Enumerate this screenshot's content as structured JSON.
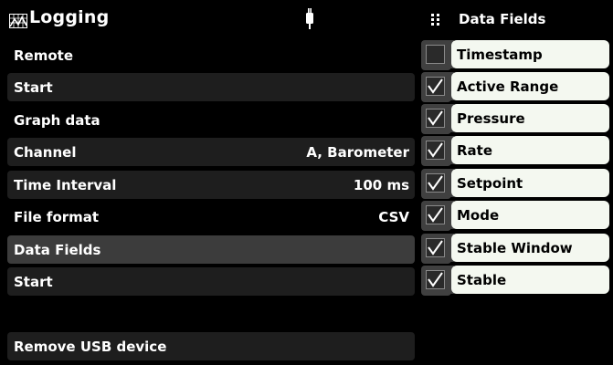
{
  "header": {
    "title": "Logging"
  },
  "menu": [
    {
      "label": "Remote",
      "value": ""
    },
    {
      "label": "Start",
      "value": ""
    },
    {
      "label": "Graph data",
      "value": ""
    },
    {
      "label": "Channel",
      "value": "A, Barometer"
    },
    {
      "label": "Time Interval",
      "value": "100 ms"
    },
    {
      "label": "File format",
      "value": "CSV"
    },
    {
      "label": "Data Fields",
      "value": ""
    },
    {
      "label": "Start",
      "value": ""
    },
    {
      "label": "Remove USB device",
      "value": ""
    }
  ],
  "panel": {
    "title": "Data Fields",
    "fields": [
      {
        "label": "Timestamp",
        "checked": false
      },
      {
        "label": "Active Range",
        "checked": true
      },
      {
        "label": "Pressure",
        "checked": true
      },
      {
        "label": "Rate",
        "checked": true
      },
      {
        "label": "Setpoint",
        "checked": true
      },
      {
        "label": "Mode",
        "checked": true
      },
      {
        "label": "Stable Window",
        "checked": true
      },
      {
        "label": "Stable",
        "checked": true
      }
    ]
  },
  "colors": {
    "background": "#000000",
    "row_fill": "#1e1e1e",
    "row_selected": "#3c3c3c",
    "field_label_bg": "#f4f8f0"
  }
}
